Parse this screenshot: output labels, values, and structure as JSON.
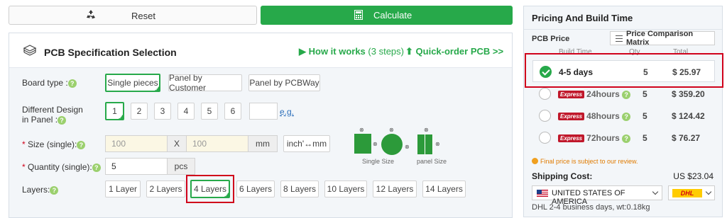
{
  "toolbar": {
    "reset_label": "Reset",
    "calculate_label": "Calculate"
  },
  "spec": {
    "title": "PCB Specification Selection",
    "how_it_works": "How it works",
    "how_it_works_sub": "(3 steps)",
    "quick_order": "Quick-order PCB >>",
    "board_type": {
      "label": "Board type :",
      "options": [
        "Single pieces",
        "Panel by Customer",
        "Panel by PCBWay"
      ],
      "selected": "Single pieces"
    },
    "different_design": {
      "label_line1": "Different Design",
      "label_line2": "in Panel :",
      "options": [
        "1",
        "2",
        "3",
        "4",
        "5",
        "6"
      ],
      "selected": "1",
      "custom_value": "",
      "example_link": "e.g."
    },
    "size": {
      "label": "Size (single):",
      "width_placeholder": "100",
      "x_label": "X",
      "height_placeholder": "100",
      "unit": "mm",
      "convert_label": "inch'↔mm"
    },
    "quantity": {
      "label": "Quantity (single):",
      "value": "5",
      "unit": "pcs"
    },
    "layers": {
      "label": "Layers:",
      "options": [
        "1 Layer",
        "2 Layers",
        "4 Layers",
        "6 Layers",
        "8 Layers",
        "10 Layers",
        "12 Layers",
        "14 Layers"
      ],
      "selected": "4 Layers"
    },
    "diagram_captions": {
      "single": "Single Size",
      "panel": "panel Size"
    }
  },
  "pricing": {
    "title": "Pricing And Build Time",
    "pcb_price_label": "PCB Price",
    "matrix_button": "Price Comparison Matrix",
    "columns": [
      "Build Time",
      "Qty",
      "Total"
    ],
    "rows": [
      {
        "time": "4-5 days",
        "express": false,
        "qty": "5",
        "total": "$ 25.97",
        "selected": true
      },
      {
        "time": "24hours",
        "express": true,
        "qty": "5",
        "total": "$ 359.20",
        "selected": false
      },
      {
        "time": "48hours",
        "express": true,
        "qty": "5",
        "total": "$ 124.42",
        "selected": false
      },
      {
        "time": "72hours",
        "express": true,
        "qty": "5",
        "total": "$ 76.27",
        "selected": false
      }
    ],
    "express_badge": "Express",
    "note": "Final price is subject to our review.",
    "shipping_label": "Shipping Cost:",
    "shipping_value": "US $23.04",
    "country": "UNITED STATES OF AMERICA",
    "carrier": "DHL",
    "shipping_note": "DHL 2-4 business days, wt:0.18kg"
  },
  "colors": {
    "accent_green": "#27a94a",
    "highlight_red": "#d0021b",
    "express_red": "#c0182b"
  }
}
